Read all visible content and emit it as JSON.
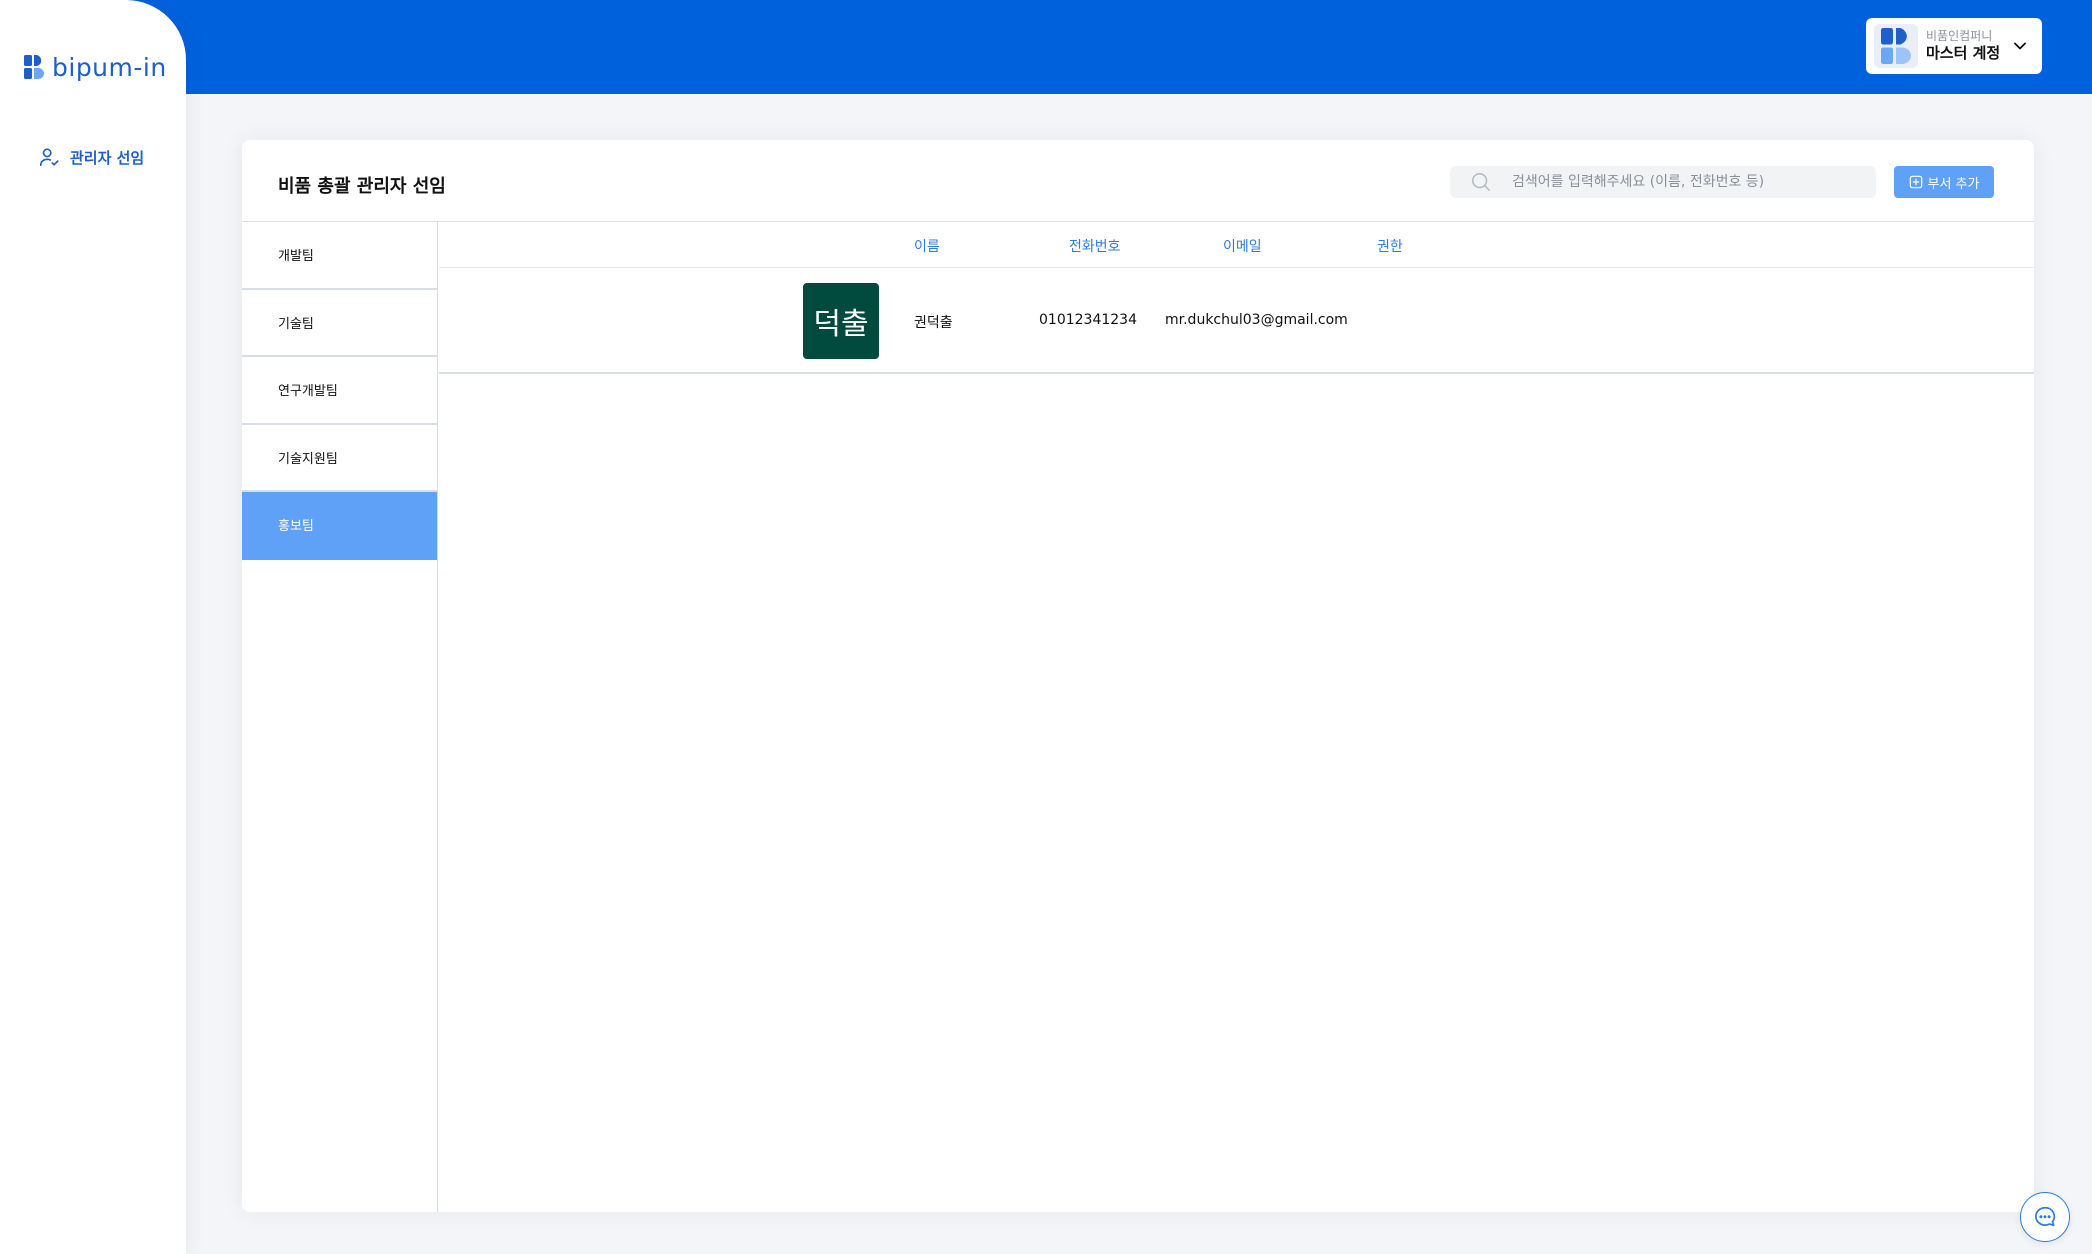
{
  "brand": {
    "logo_text": "bipum-in"
  },
  "sidebar": {
    "items": [
      {
        "label": "관리자 선임"
      }
    ]
  },
  "account": {
    "company": "비품인컴퍼니",
    "role": "마스터 계정"
  },
  "page": {
    "title": "비품 총괄 관리자 선임",
    "search_placeholder": "검색어를 입력해주세요 (이름, 전화번호 등)",
    "add_button_label": "부서 추가"
  },
  "departments": [
    {
      "label": "개발팀"
    },
    {
      "label": "기술팀"
    },
    {
      "label": "연구개발팀"
    },
    {
      "label": "기술지원팀"
    },
    {
      "label": "홍보팀",
      "selected": true
    }
  ],
  "table": {
    "columns": [
      "이름",
      "전화번호",
      "이메일",
      "권한"
    ],
    "rows": [
      {
        "avatar_text": "덕출",
        "name": "권덕출",
        "phone": "01012341234",
        "email": "mr.dukchul03@gmail.com",
        "role": ""
      }
    ]
  },
  "colors": {
    "primary": "#0061dd",
    "accent": "#5ea1f7",
    "avatar_bg": "#004b3d"
  }
}
